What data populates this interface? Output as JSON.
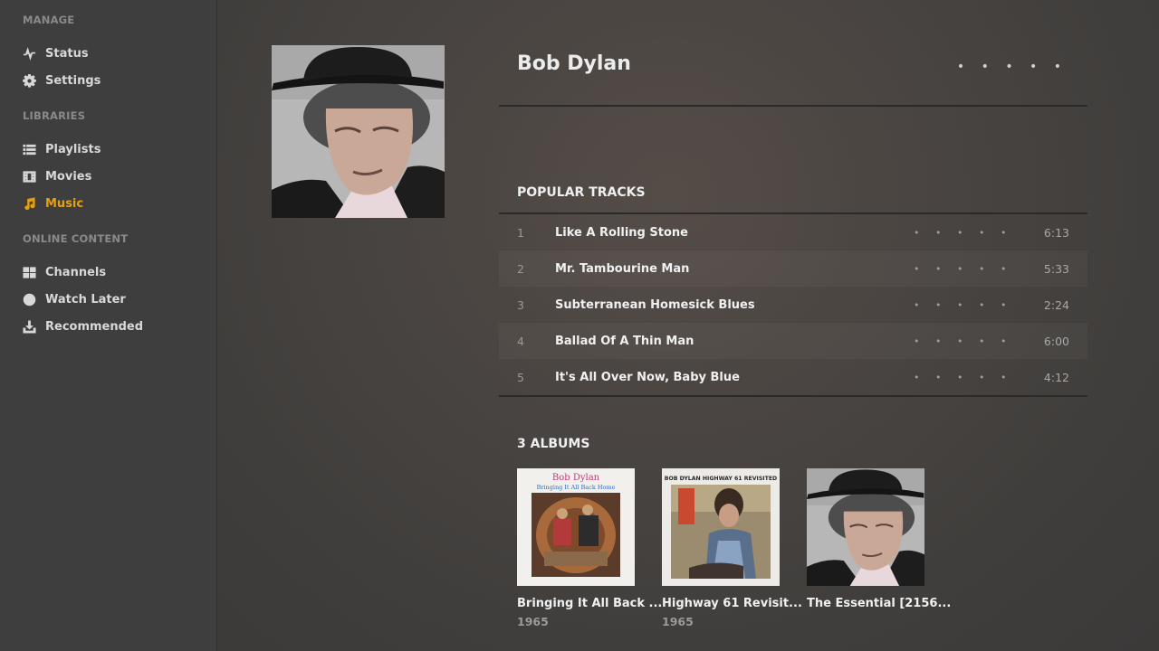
{
  "sidebar": {
    "sections": [
      {
        "heading": "MANAGE",
        "items": [
          {
            "label": "Status",
            "icon": "status-pulse-icon"
          },
          {
            "label": "Settings",
            "icon": "gear-icon"
          }
        ]
      },
      {
        "heading": "LIBRARIES",
        "items": [
          {
            "label": "Playlists",
            "icon": "list-icon"
          },
          {
            "label": "Movies",
            "icon": "film-icon"
          },
          {
            "label": "Music",
            "icon": "music-note-icon",
            "active": true
          }
        ]
      },
      {
        "heading": "ONLINE CONTENT",
        "items": [
          {
            "label": "Channels",
            "icon": "grid-icon"
          },
          {
            "label": "Watch Later",
            "icon": "clock-icon"
          },
          {
            "label": "Recommended",
            "icon": "download-icon"
          }
        ]
      }
    ]
  },
  "artist": {
    "name": "Bob Dylan",
    "more_menu": "• • • • •"
  },
  "popular_tracks": {
    "title": "POPULAR TRACKS",
    "rating_dots": "• • • • •",
    "tracks": [
      {
        "num": "1",
        "title": "Like A Rolling Stone",
        "duration": "6:13"
      },
      {
        "num": "2",
        "title": "Mr. Tambourine Man",
        "duration": "5:33"
      },
      {
        "num": "3",
        "title": "Subterranean Homesick Blues",
        "duration": "2:24"
      },
      {
        "num": "4",
        "title": "Ballad Of A Thin Man",
        "duration": "6:00"
      },
      {
        "num": "5",
        "title": "It's All Over Now, Baby Blue",
        "duration": "4:12"
      }
    ]
  },
  "albums": {
    "title": "3 ALBUMS",
    "items": [
      {
        "title": "Bringing It All Back ...",
        "year": "1965",
        "cover_text_1": "Bob Dylan",
        "cover_text_2": "Bringing It All Back Home"
      },
      {
        "title": "Highway 61 Revisit...",
        "year": "1965",
        "cover_text_1": "BOB DYLAN HIGHWAY 61 REVISITED"
      },
      {
        "title": "The Essential [2156...",
        "year": ""
      }
    ]
  },
  "colors": {
    "accent": "#e5a00d",
    "sidebar_bg": "#3e3e3e",
    "main_bg": "#4a4542"
  }
}
